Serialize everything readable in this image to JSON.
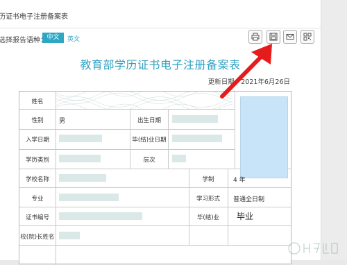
{
  "panel": {
    "title": "历证书电子注册备案表"
  },
  "language": {
    "label": "选择报告语种：",
    "options": [
      "中文",
      "英文"
    ],
    "selected": "中文"
  },
  "toolbar": {
    "icons": [
      "printer-icon",
      "save-icon",
      "mail-icon",
      "qrcode-icon"
    ]
  },
  "document": {
    "title": "教育部学历证书电子注册备案表",
    "updated": "更新日期：2021年6月26日"
  },
  "table": {
    "name_label": "姓名",
    "gender_label": "性别",
    "gender_value": "男",
    "birth_label": "出生日期",
    "enroll_label": "入学日期",
    "grad_label": "毕(结)业日期",
    "category_label": "学历类别",
    "level_label": "层次",
    "school_label": "学校名称",
    "duration_label": "学制",
    "duration_value": "4 年",
    "major_label": "专业",
    "mode_label": "学习形式",
    "mode_value": "普通全日制",
    "cert_label": "证书编号",
    "status_label": "毕(结)业",
    "status_value": "毕业",
    "president_label": "校(院)长姓名"
  },
  "colors": {
    "accent": "#2ea7c4",
    "title": "#2fa1c2",
    "arrow": "#e61c1c",
    "photo": "#c8e4f8"
  }
}
